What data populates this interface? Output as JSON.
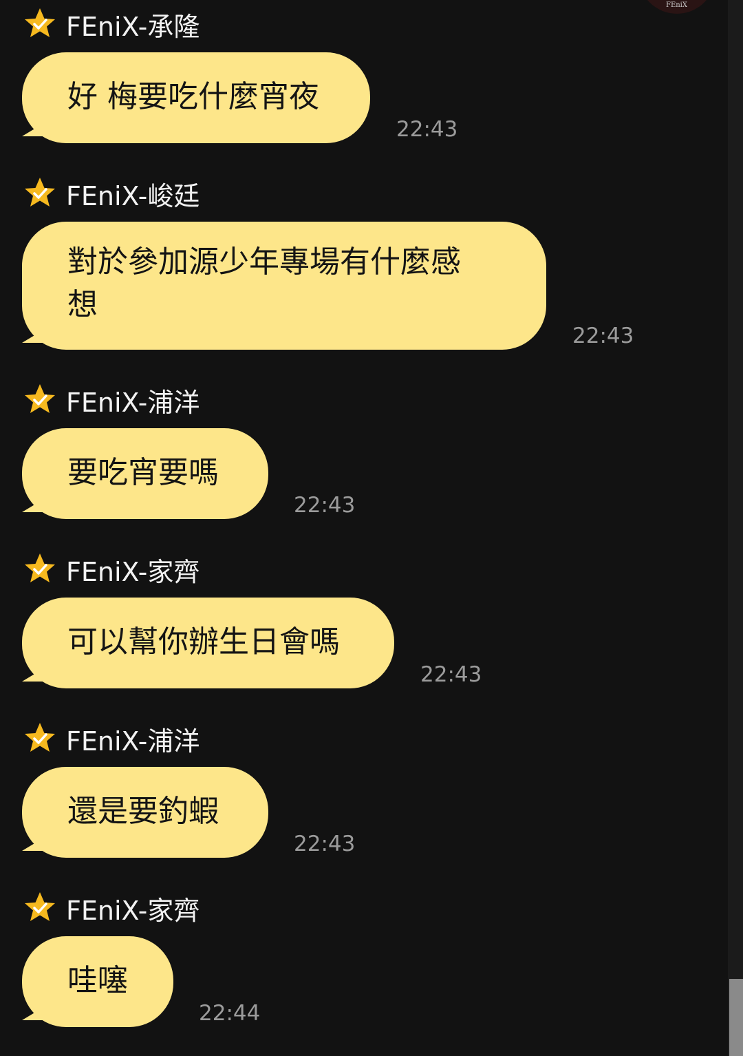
{
  "chat": {
    "top_avatar": {
      "logo": "FEniX"
    },
    "icon": "star-check-icon",
    "colors": {
      "background": "#121212",
      "bubble": "#fde68a",
      "star": "#f6b91f",
      "time": "#9b9b9b",
      "name": "#f2f2f2"
    },
    "messages": [
      {
        "sender": "FEniX-承隆",
        "lines": [
          "好 梅要吃什麼宵夜"
        ],
        "time": "22:43"
      },
      {
        "sender": "FEniX-峻廷",
        "lines": [
          "對於參加源少年專場有什麼感",
          "想"
        ],
        "time": "22:43"
      },
      {
        "sender": "FEniX-浦洋",
        "lines": [
          "要吃宵要嗎"
        ],
        "time": "22:43"
      },
      {
        "sender": "FEniX-家齊",
        "lines": [
          "可以幫你辦生日會嗎"
        ],
        "time": "22:43"
      },
      {
        "sender": "FEniX-浦洋",
        "lines": [
          "還是要釣蝦"
        ],
        "time": "22:43"
      },
      {
        "sender": "FEniX-家齊",
        "lines": [
          "哇噻"
        ],
        "time": "22:44"
      }
    ]
  }
}
